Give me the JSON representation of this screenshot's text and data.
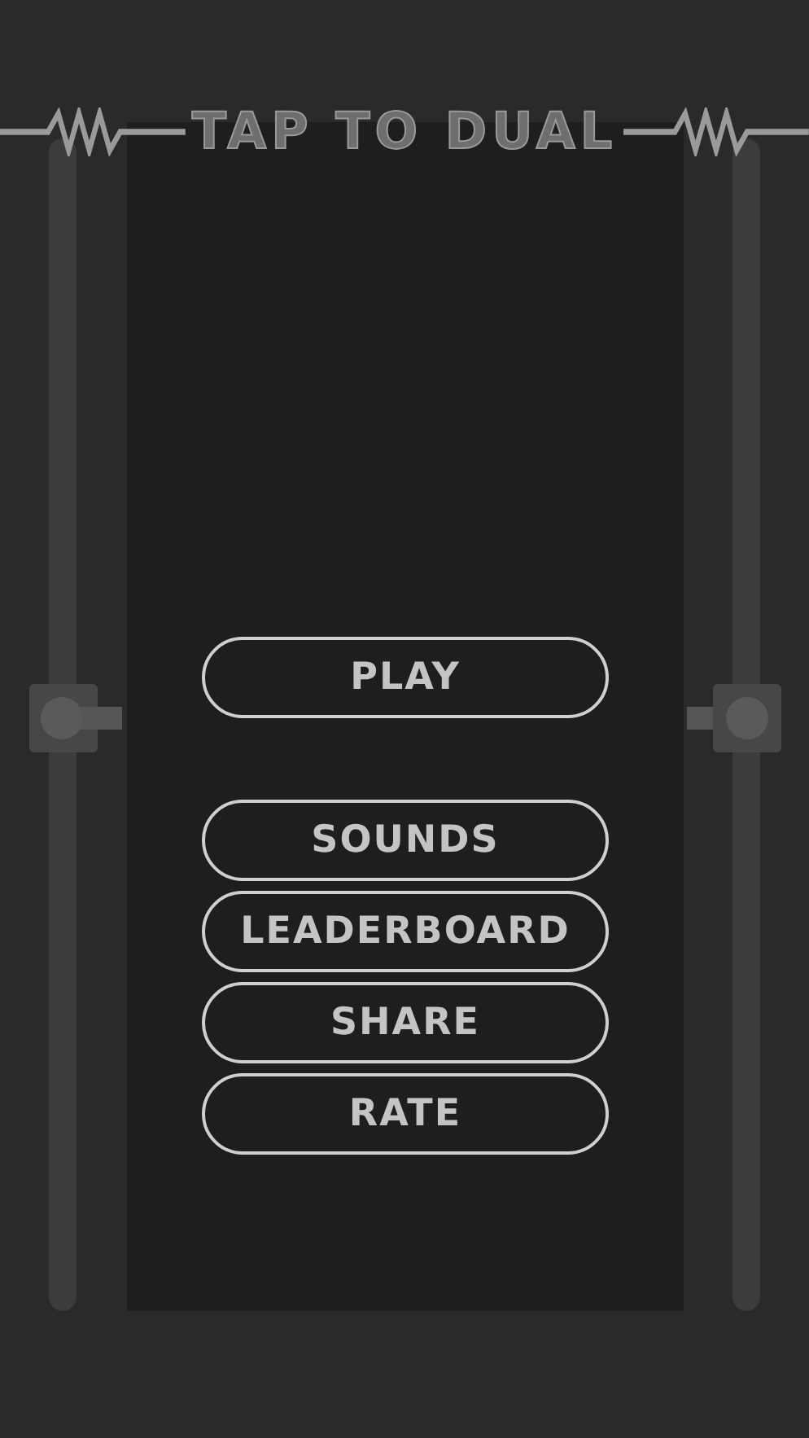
{
  "title": "TAP TO DUAL",
  "menu": [
    {
      "label": "PLAY"
    },
    {
      "label": "SOUNDS"
    },
    {
      "label": "LEADERBOARD"
    },
    {
      "label": "SHARE"
    },
    {
      "label": "RATE"
    }
  ]
}
